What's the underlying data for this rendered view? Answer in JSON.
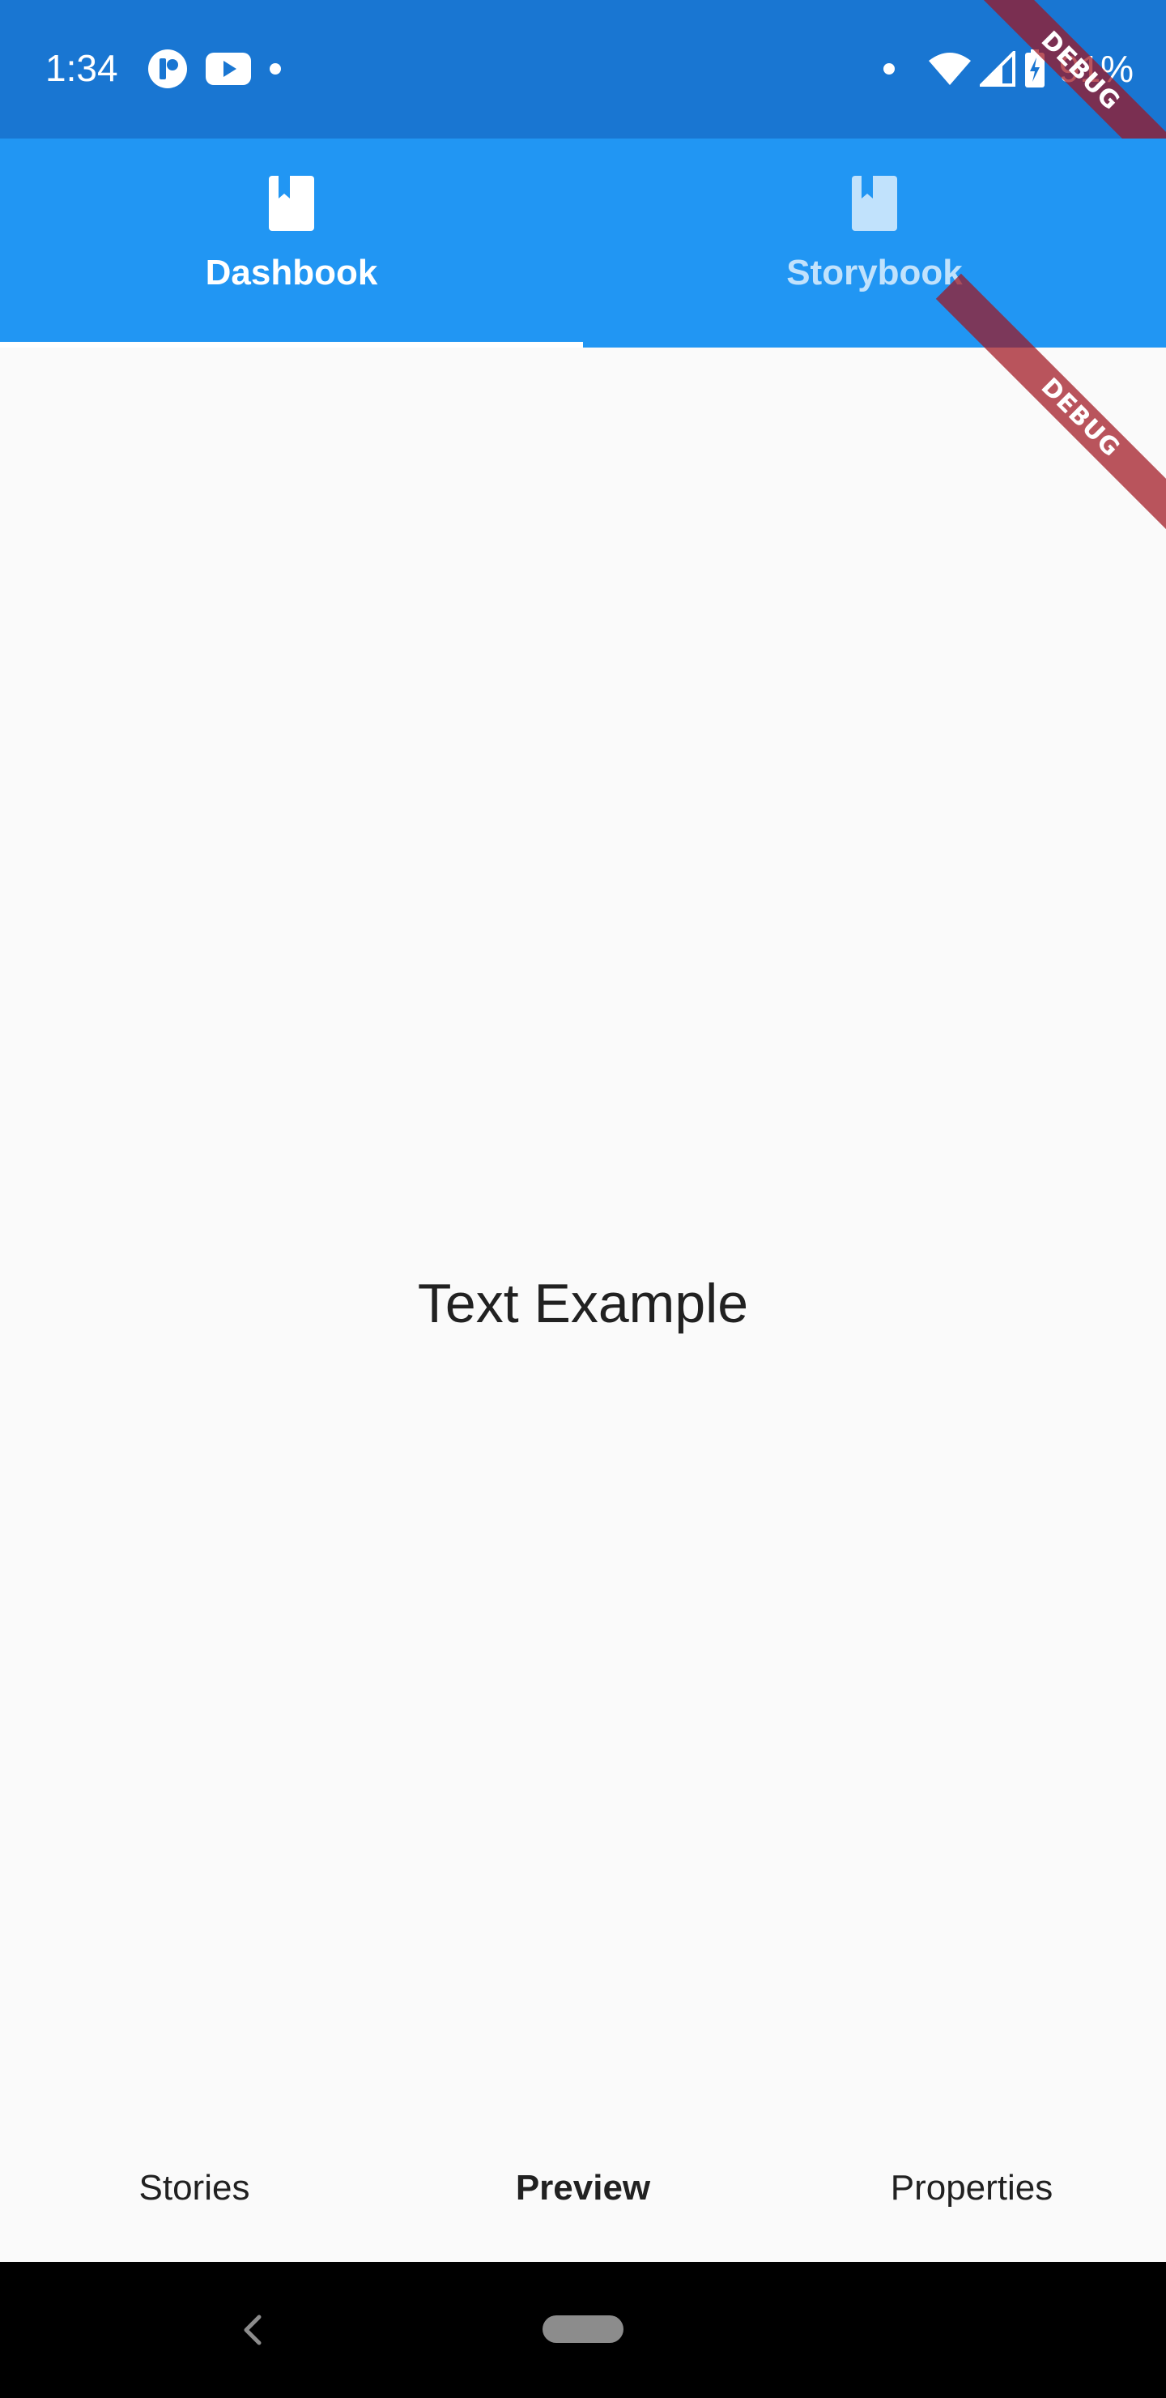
{
  "status_bar": {
    "time": "1:34",
    "battery": "91%",
    "left_icons": [
      "app-notification-icon",
      "youtube-icon",
      "dot-icon"
    ],
    "right_icons": [
      "dot-icon",
      "wifi-icon",
      "cell-signal-icon",
      "battery-charging-icon"
    ]
  },
  "tabs": [
    {
      "label": "Dashbook",
      "icon": "book-icon",
      "active": true
    },
    {
      "label": "Storybook",
      "icon": "book-icon",
      "active": false
    }
  ],
  "debug_banner": "DEBUG",
  "content": {
    "text": "Text Example"
  },
  "bottom_tabs": [
    {
      "label": "Stories",
      "selected": false
    },
    {
      "label": "Preview",
      "selected": true
    },
    {
      "label": "Properties",
      "selected": false
    }
  ],
  "colors": {
    "status_bar": "#1976d2",
    "app_bar": "#2196f3",
    "background": "#fafafa",
    "debug_banner": "#a0141e"
  }
}
